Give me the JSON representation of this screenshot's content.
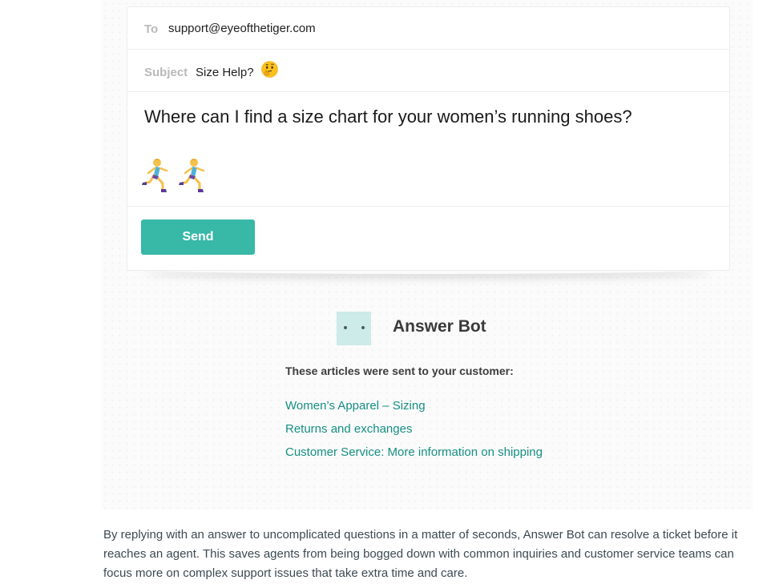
{
  "email": {
    "to_label": "To",
    "to_value": "support@eyeofthetiger.com",
    "subject_label": "Subject",
    "subject_value": "Size Help?",
    "subject_icon": "thinking-face-emoji",
    "message": "Where can I find a size chart for your women’s running shoes?",
    "emoji_icons": [
      "woman-running-emoji",
      "woman-running-emoji"
    ],
    "send_label": "Send"
  },
  "answer_bot": {
    "name": "Answer Bot",
    "articles_heading": "These articles were sent to your customer:",
    "articles": [
      "Women’s Apparel – Sizing",
      "Returns and exchanges",
      "Customer Service: More information on shipping"
    ]
  },
  "description": "By replying with an answer to uncomplicated questions in a matter of seconds, Answer Bot can resolve a ticket before it reaches an agent. This saves agents from being bogged down with common inquiries and customer service teams can focus more on complex support issues that take extra time and care.",
  "colors": {
    "accent": "#38b8a7",
    "link": "#168f83",
    "bot_avatar": "#cdebe8"
  }
}
